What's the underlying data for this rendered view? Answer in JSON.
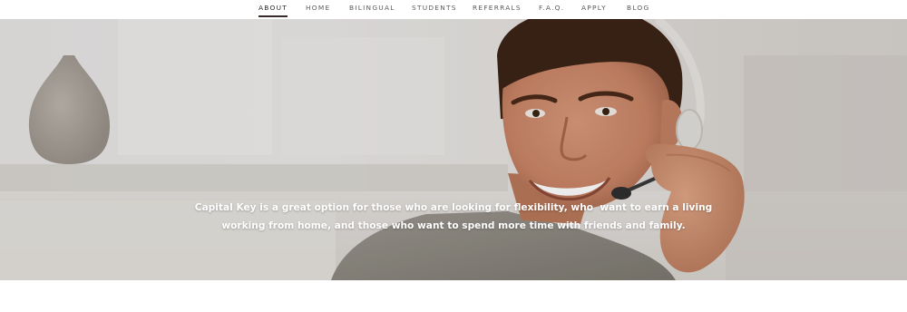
{
  "nav": {
    "items": [
      {
        "label": "ABOUT",
        "active": true
      },
      {
        "label": "HOME",
        "active": false
      },
      {
        "label": "BILINGUAL",
        "active": false
      },
      {
        "label": "STUDENTS",
        "active": false
      },
      {
        "label": "REFERRALS",
        "active": false
      },
      {
        "label": "F.A.Q.",
        "active": false
      },
      {
        "label": "APPLY",
        "active": false
      },
      {
        "label": "BLOG",
        "active": false
      }
    ]
  },
  "hero": {
    "line1": "Capital Key is a great option for those who are looking for flexibility, who  want to earn a living",
    "line2": "working from home, and those who want to spend more time with friends and family."
  },
  "colors": {
    "nav_text": "#5b5b5b",
    "nav_active": "#2a2a2a",
    "underline": "#3a2a2a",
    "hero_text": "#ffffff"
  }
}
